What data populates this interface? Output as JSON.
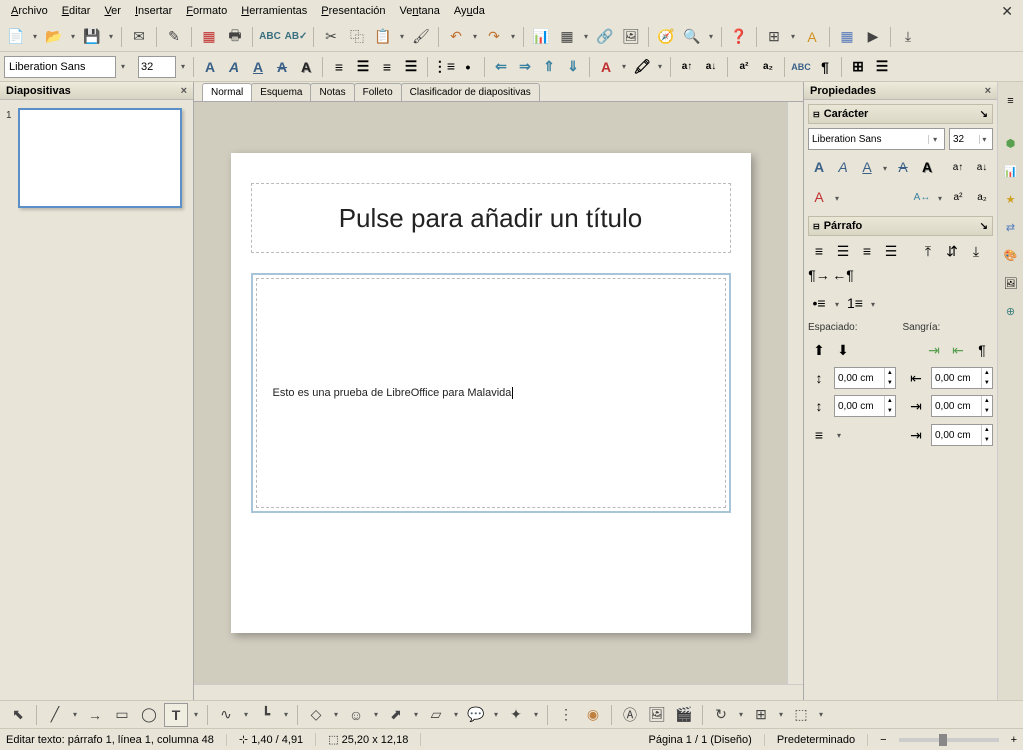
{
  "menu": {
    "archivo": "Archivo",
    "editar": "Editar",
    "ver": "Ver",
    "insertar": "Insertar",
    "formato": "Formato",
    "herramientas": "Herramientas",
    "presentacion": "Presentación",
    "ventana": "Ventana",
    "ayuda": "Ayuda"
  },
  "font": {
    "name": "Liberation Sans",
    "size": "32"
  },
  "panels": {
    "slides_title": "Diapositivas",
    "slide_num": "1",
    "props_title": "Propiedades",
    "char_section": "Carácter",
    "para_section": "Párrafo",
    "spacing_label": "Espaciado:",
    "indent_label": "Sangría:",
    "spacing_val": "0,00 cm"
  },
  "view_tabs": {
    "normal": "Normal",
    "outline": "Esquema",
    "notes": "Notas",
    "handout": "Folleto",
    "sorter": "Clasificador de diapositivas"
  },
  "slide": {
    "title_placeholder": "Pulse para añadir un título",
    "content_text": "Esto es una prueba de LibreOffice para Malavida"
  },
  "props": {
    "font_name": "Liberation Sans",
    "font_size": "32"
  },
  "status": {
    "edit": "Editar texto: párrafo 1, línea 1, columna 48",
    "pos1": "1,40 / 4,91",
    "pos2": "25,20 x 12,18",
    "page": "Página 1 / 1 (Diseño)",
    "style": "Predeterminado"
  }
}
